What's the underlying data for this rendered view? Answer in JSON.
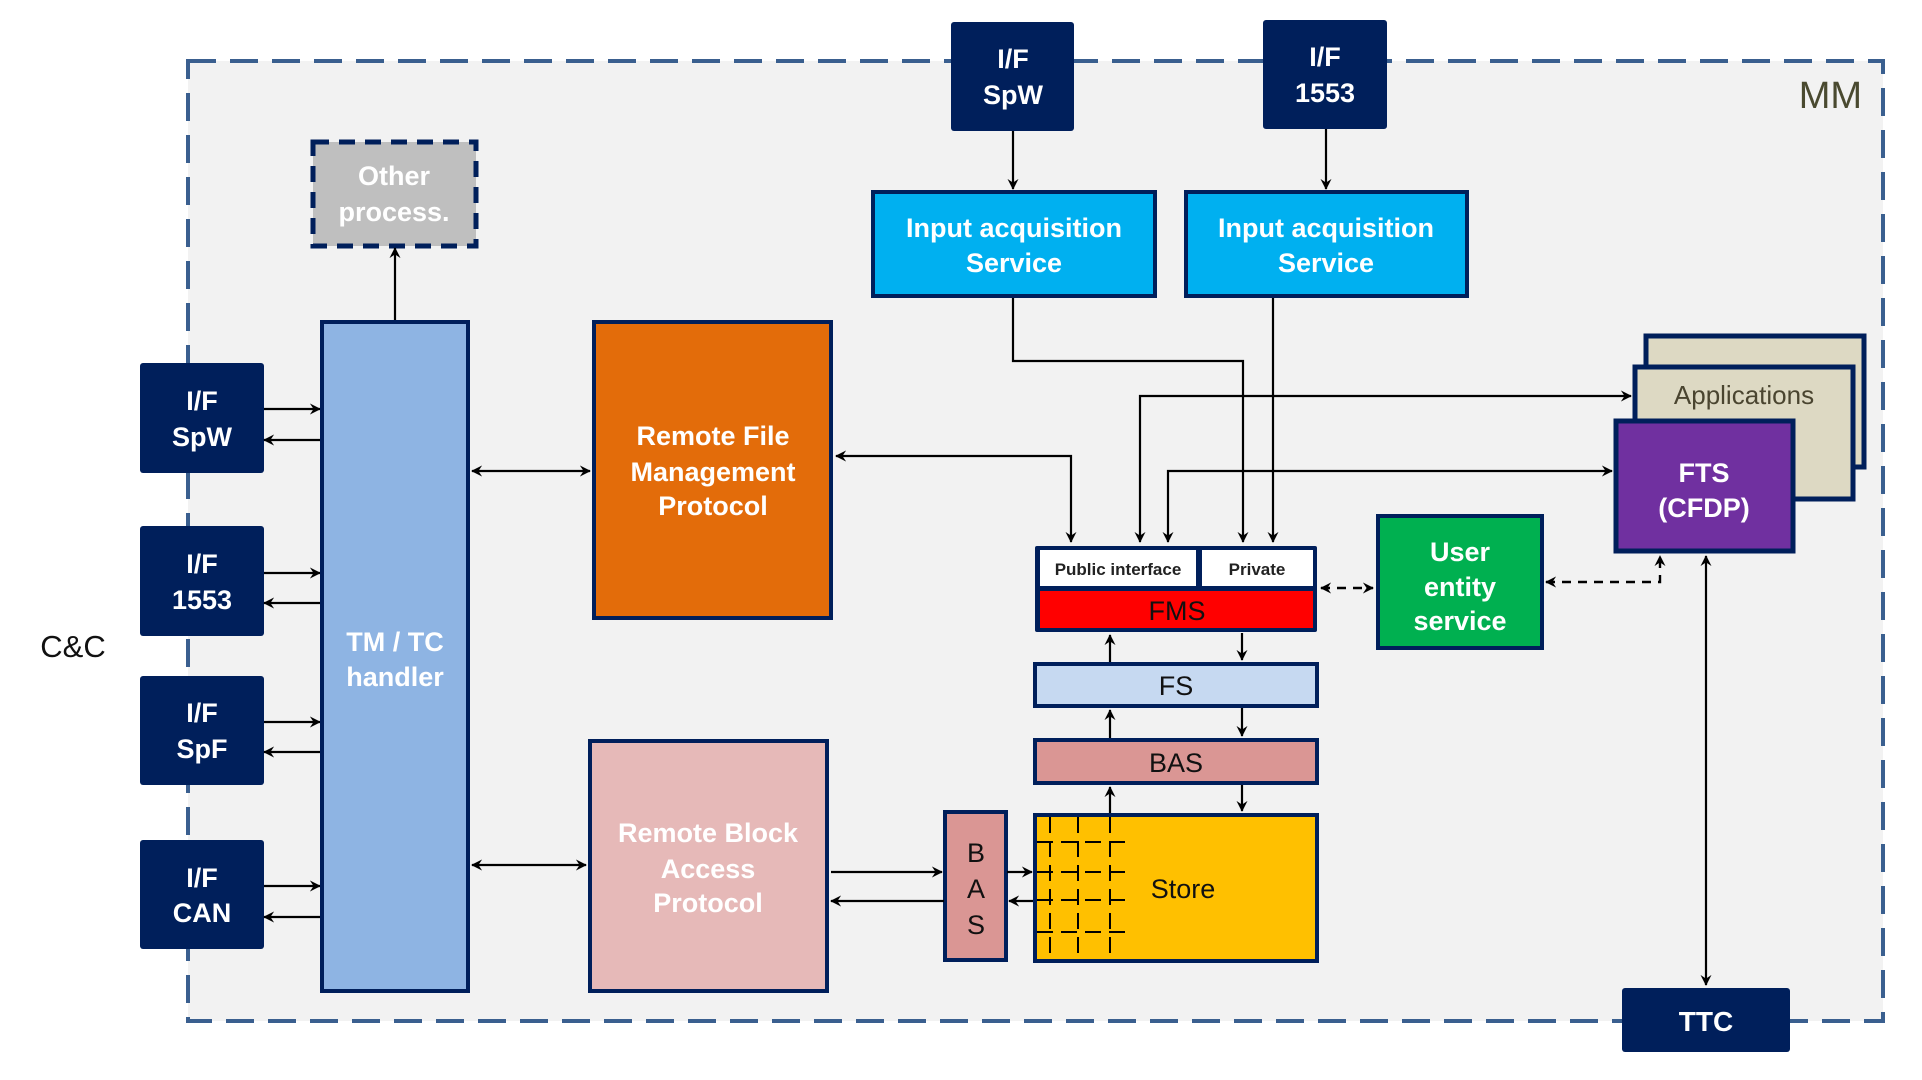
{
  "diagram": {
    "container_label": "MM",
    "external_label": "C&C",
    "colors": {
      "navy": "#001f5b",
      "mm_border": "#3a5f8f",
      "mm_fill": "#f2f2f2",
      "tmtc": "#8eb4e3",
      "rfmp": "#e36c0a",
      "rbap": "#e6b9b8",
      "input_acq": "#00b0f0",
      "fms": "#ff0000",
      "fs": "#c6d9f1",
      "bas": "#da9694",
      "store": "#ffc000",
      "user_entity": "#00b050",
      "fts": "#7030a0",
      "applications": "#ddd9c3",
      "other_process": "#bfbfbf"
    },
    "cc_interfaces": [
      {
        "line1": "I/F",
        "line2": "SpW"
      },
      {
        "line1": "I/F",
        "line2": "1553"
      },
      {
        "line1": "I/F",
        "line2": "SpF"
      },
      {
        "line1": "I/F",
        "line2": "CAN"
      }
    ],
    "top_interfaces": [
      {
        "line1": "I/F",
        "line2": "SpW"
      },
      {
        "line1": "I/F",
        "line2": "1553"
      }
    ],
    "other_process": {
      "line1": "Other",
      "line2": "process."
    },
    "tmtc_handler": {
      "line1": "TM / TC",
      "line2": "handler"
    },
    "rfmp": {
      "line1": "Remote File",
      "line2": "Management",
      "line3": "Protocol"
    },
    "rbap": {
      "line1": "Remote Block",
      "line2": "Access",
      "line3": "Protocol"
    },
    "input_acquisition": [
      {
        "line1": "Input acquisition",
        "line2": "Service"
      },
      {
        "line1": "Input acquisition",
        "line2": "Service"
      }
    ],
    "fms_block": {
      "public_interface": "Public interface",
      "private": "Private",
      "fms": "FMS"
    },
    "fs": "FS",
    "bas_horizontal": "BAS",
    "bas_vertical": {
      "l1": "B",
      "l2": "A",
      "l3": "S"
    },
    "store": "Store",
    "user_entity": {
      "line1": "User",
      "line2": "entity",
      "line3": "service"
    },
    "applications": "Applications",
    "fts": {
      "line1": "FTS",
      "line2": "(CFDP)"
    },
    "ttc": "TTC"
  }
}
